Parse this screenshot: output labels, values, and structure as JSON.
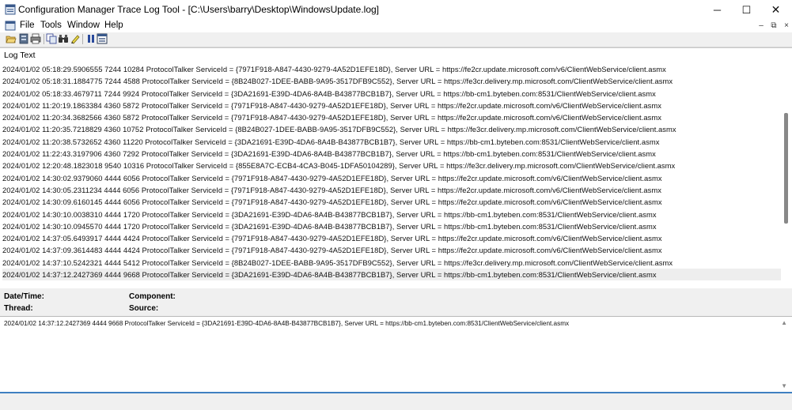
{
  "window": {
    "title": "Configuration Manager Trace Log Tool - [C:\\Users\\barry\\Desktop\\WindowsUpdate.log]",
    "minimize_glyph": "─",
    "maximize_glyph": "☐",
    "close_glyph": "✕"
  },
  "menu": {
    "items": [
      "File",
      "Tools",
      "Window",
      "Help"
    ],
    "mdi_minimize": "–",
    "mdi_restore": "⧉",
    "mdi_close": "×"
  },
  "toolbar": {
    "buttons": [
      "open-icon",
      "open-on-server-icon",
      "print-icon",
      "copy-icon",
      "find-icon",
      "highlight-icon",
      "pause-icon",
      "split-view-icon"
    ]
  },
  "list": {
    "header": "Log Text",
    "rows": [
      "2024/01/02 05:18:29.5906555 7244  10284 ProtocolTalker  ServiceId = {7971F918-A847-4430-9279-4A52D1EFE18D}, Server URL = https://fe2cr.update.microsoft.com/v6/ClientWebService/client.asmx",
      "2024/01/02 05:18:31.1884775 7244  4588  ProtocolTalker  ServiceId = {8B24B027-1DEE-BABB-9A95-3517DFB9C552}, Server URL = https://fe3cr.delivery.mp.microsoft.com/ClientWebService/client.asmx",
      "2024/01/02 05:18:33.4679711 7244  9924  ProtocolTalker  ServiceId = {3DA21691-E39D-4DA6-8A4B-B43877BCB1B7}, Server URL = https://bb-cm1.byteben.com:8531/ClientWebService/client.asmx",
      "2024/01/02 11:20:19.1863384 4360  5872  ProtocolTalker  ServiceId = {7971F918-A847-4430-9279-4A52D1EFE18D}, Server URL = https://fe2cr.update.microsoft.com/v6/ClientWebService/client.asmx",
      "2024/01/02 11:20:34.3682566 4360  5872  ProtocolTalker  ServiceId = {7971F918-A847-4430-9279-4A52D1EFE18D}, Server URL = https://fe2cr.update.microsoft.com/v6/ClientWebService/client.asmx",
      "2024/01/02 11:20:35.7218829 4360  10752 ProtocolTalker  ServiceId = {8B24B027-1DEE-BABB-9A95-3517DFB9C552}, Server URL = https://fe3cr.delivery.mp.microsoft.com/ClientWebService/client.asmx",
      "2024/01/02 11:20:38.5732652 4360  11220 ProtocolTalker  ServiceId = {3DA21691-E39D-4DA6-8A4B-B43877BCB1B7}, Server URL = https://bb-cm1.byteben.com:8531/ClientWebService/client.asmx",
      "2024/01/02 11:22:43.3197906 4360  7292  ProtocolTalker  ServiceId = {3DA21691-E39D-4DA6-8A4B-B43877BCB1B7}, Server URL = https://bb-cm1.byteben.com:8531/ClientWebService/client.asmx",
      "2024/01/02 12:20:48.1823018 9540  10316 ProtocolTalker  ServiceId = {855E8A7C-ECB4-4CA3-B045-1DFA50104289}, Server URL = https://fe3cr.delivery.mp.microsoft.com/ClientWebService/client.asmx",
      "2024/01/02 14:30:02.9379060 4444  6056  ProtocolTalker  ServiceId = {7971F918-A847-4430-9279-4A52D1EFE18D}, Server URL = https://fe2cr.update.microsoft.com/v6/ClientWebService/client.asmx",
      "2024/01/02 14:30:05.2311234 4444  6056  ProtocolTalker  ServiceId = {7971F918-A847-4430-9279-4A52D1EFE18D}, Server URL = https://fe2cr.update.microsoft.com/v6/ClientWebService/client.asmx",
      "2024/01/02 14:30:09.6160145 4444  6056  ProtocolTalker  ServiceId = {7971F918-A847-4430-9279-4A52D1EFE18D}, Server URL = https://fe2cr.update.microsoft.com/v6/ClientWebService/client.asmx",
      "2024/01/02 14:30:10.0038310 4444  1720  ProtocolTalker  ServiceId = {3DA21691-E39D-4DA6-8A4B-B43877BCB1B7}, Server URL = https://bb-cm1.byteben.com:8531/ClientWebService/client.asmx",
      "2024/01/02 14:30:10.0945570 4444  1720  ProtocolTalker  ServiceId = {3DA21691-E39D-4DA6-8A4B-B43877BCB1B7}, Server URL = https://bb-cm1.byteben.com:8531/ClientWebService/client.asmx",
      "2024/01/02 14:37:05.6493917 4444  4424  ProtocolTalker  ServiceId = {7971F918-A847-4430-9279-4A52D1EFE18D}, Server URL = https://fe2cr.update.microsoft.com/v6/ClientWebService/client.asmx",
      "2024/01/02 14:37:09.3614483 4444  4424  ProtocolTalker  ServiceId = {7971F918-A847-4430-9279-4A52D1EFE18D}, Server URL = https://fe2cr.update.microsoft.com/v6/ClientWebService/client.asmx",
      "2024/01/02 14:37:10.5242321 4444  5412  ProtocolTalker  ServiceId = {8B24B027-1DEE-BABB-9A95-3517DFB9C552}, Server URL = https://fe3cr.delivery.mp.microsoft.com/ClientWebService/client.asmx",
      "2024/01/02 14:37:12.2427369 4444  9668  ProtocolTalker  ServiceId = {3DA21691-E39D-4DA6-8A4B-B43877BCB1B7}, Server URL = https://bb-cm1.byteben.com:8531/ClientWebService/client.asmx"
    ],
    "selected_index": 17,
    "scroll_position": 0.5
  },
  "details": {
    "datetime_label": "Date/Time:",
    "component_label": "Component:",
    "thread_label": "Thread:",
    "source_label": "Source:"
  },
  "message": {
    "text": "2024/01/02 14:37:12.2427369 4444  9668  ProtocolTalker  ServiceId = {3DA21691-E39D-4DA6-8A4B-B43877BCB1B7}, Server URL = https://bb-cm1.byteben.com:8531/ClientWebService/client.asmx",
    "scroll_up": "▲",
    "scroll_down": "▼"
  },
  "colors": {
    "selection": "#eeeeee",
    "status_accent": "#3f7fc1"
  }
}
